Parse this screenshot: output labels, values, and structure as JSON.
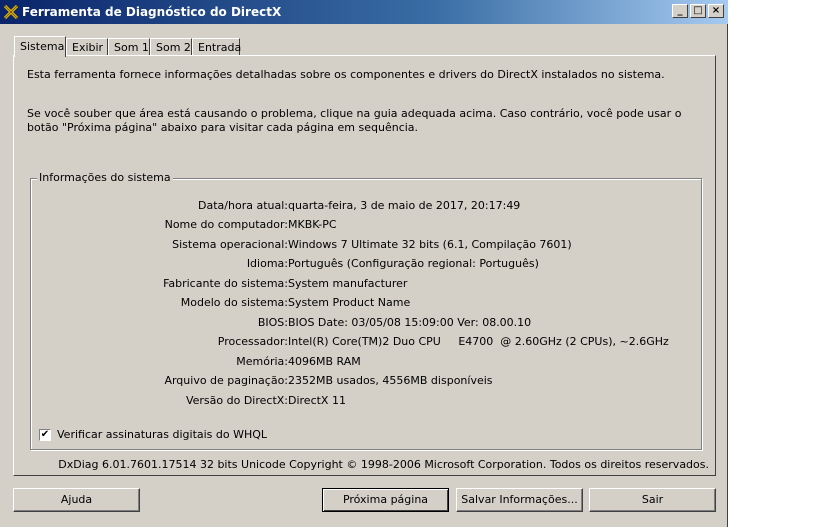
{
  "window": {
    "title": "Ferramenta de Diagnóstico do DirectX",
    "controls": {
      "minimize": "_",
      "maximize": "□",
      "close": "×"
    }
  },
  "tabs": [
    {
      "label": "Sistema",
      "active": true
    },
    {
      "label": "Exibir"
    },
    {
      "label": "Som 1"
    },
    {
      "label": "Som 2"
    },
    {
      "label": "Entrada"
    }
  ],
  "intro": {
    "p1": "Esta ferramenta fornece informações detalhadas sobre os componentes e drivers do DirectX instalados no sistema.",
    "p2": "Se você souber que área está causando o problema, clique na guia adequada acima. Caso contrário, você pode usar o botão \"Próxima página\" abaixo para visitar cada página em sequência."
  },
  "system_info": {
    "group_label": "Informações do sistema",
    "rows": [
      {
        "label": "Data/hora atual:",
        "value": "quarta-feira, 3 de maio de 2017, 20:17:49"
      },
      {
        "label": "Nome do computador:",
        "value": "MKBK-PC"
      },
      {
        "label": "Sistema operacional:",
        "value": "Windows 7 Ultimate 32 bits (6.1, Compilação 7601)"
      },
      {
        "label": "Idioma:",
        "value": "Português (Configuração regional: Português)"
      },
      {
        "label": "Fabricante do sistema:",
        "value": "System manufacturer"
      },
      {
        "label": "Modelo do sistema:",
        "value": "System Product Name"
      },
      {
        "label": "BIOS:",
        "value": "BIOS Date: 03/05/08 15:09:00 Ver: 08.00.10"
      },
      {
        "label": "Processador:",
        "value": "Intel(R) Core(TM)2 Duo CPU     E4700  @ 2.60GHz (2 CPUs), ~2.6GHz"
      },
      {
        "label": "Memória:",
        "value": "4096MB RAM"
      },
      {
        "label": "Arquivo de paginação:",
        "value": "2352MB usados, 4556MB disponíveis"
      },
      {
        "label": "Versão do DirectX:",
        "value": "DirectX 11"
      }
    ],
    "whql_checkbox": {
      "label": "Verificar assinaturas digitais do WHQL",
      "checked": true,
      "mark": "✔"
    }
  },
  "footer": "DxDiag 6.01.7601.17514 32 bits Unicode  Copyright © 1998-2006 Microsoft Corporation.  Todos os direitos reservados.",
  "buttons": {
    "help": "Ajuda",
    "next": "Próxima página",
    "save": "Salvar Informações...",
    "exit": "Sair"
  },
  "icons": {
    "app": "directx-x-icon"
  },
  "colors": {
    "title_start": "#0a246a",
    "title_end": "#a6caf0",
    "face": "#d4d0c8"
  }
}
